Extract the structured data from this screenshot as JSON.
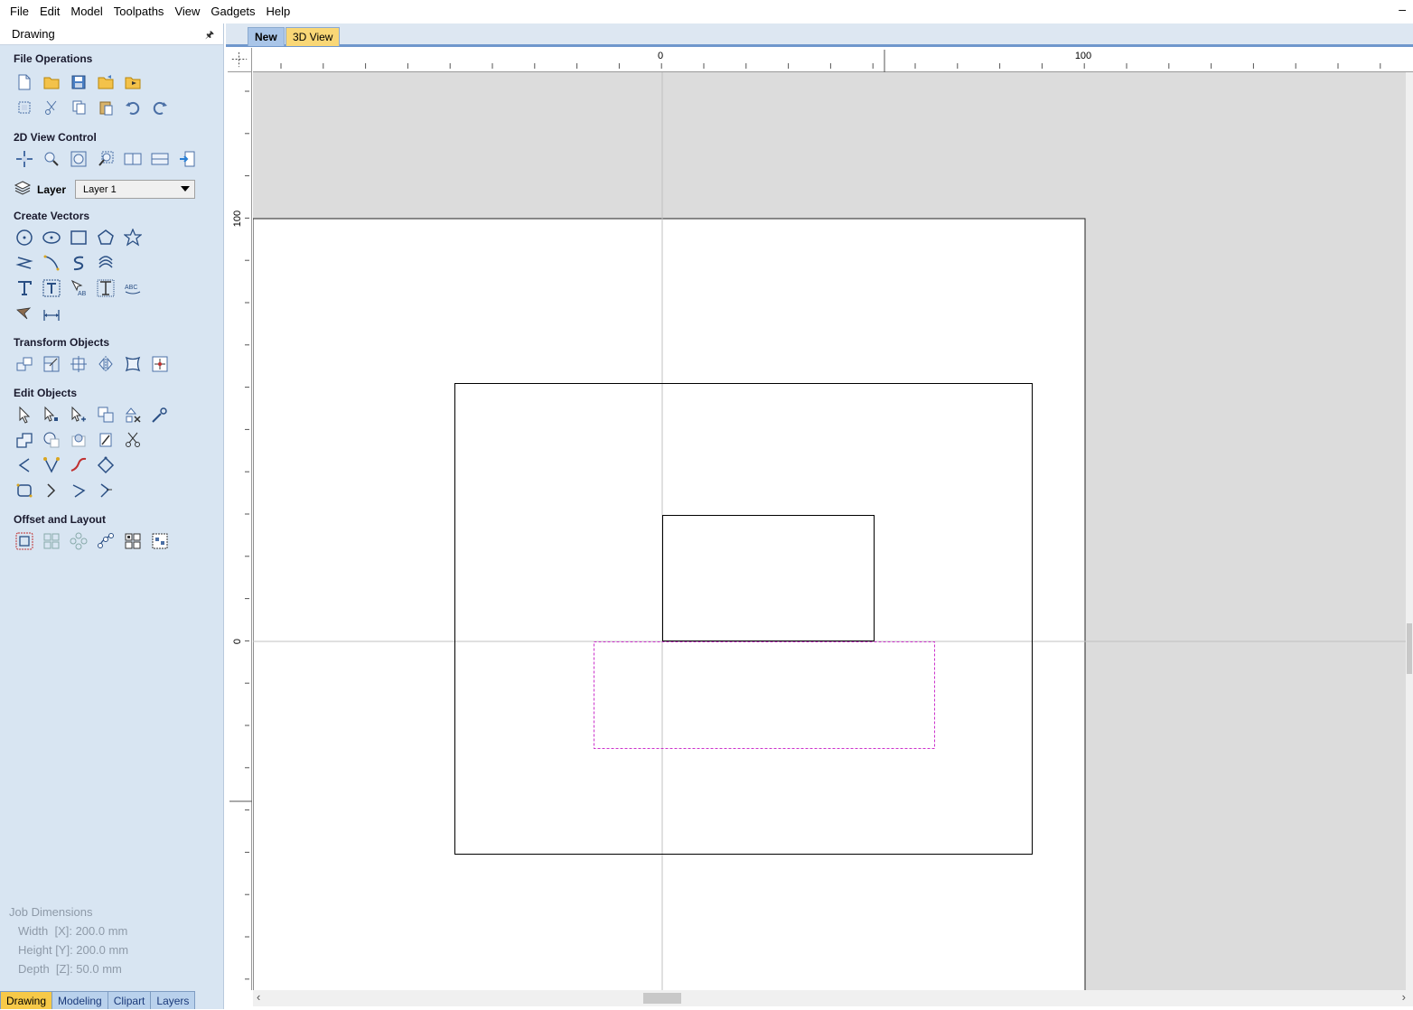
{
  "menu": [
    "File",
    "Edit",
    "Model",
    "Toolpaths",
    "View",
    "Gadgets",
    "Help"
  ],
  "menu_minimize": "–",
  "panel": {
    "title": "Drawing",
    "pin": "🖈",
    "sections": {
      "file_operations": "File Operations",
      "view_control": "2D View Control",
      "create_vectors": "Create Vectors",
      "transform_objects": "Transform Objects",
      "edit_objects": "Edit Objects",
      "offset_layout": "Offset and Layout"
    },
    "layer": {
      "label": "Layer",
      "selected": "Layer 1"
    }
  },
  "job_dimensions": {
    "title": "Job Dimensions",
    "width": "Width  [X]: 200.0 mm",
    "height": "Height [Y]: 200.0 mm",
    "depth": "Depth  [Z]: 50.0 mm"
  },
  "bottom_tabs": [
    "Drawing",
    "Modeling",
    "Clipart",
    "Layers"
  ],
  "doc_tabs": [
    "New",
    "3D View"
  ],
  "rulers": {
    "h_labels": [
      "0",
      "100"
    ],
    "v_labels": [
      "100",
      "0"
    ]
  },
  "colors": {
    "panel_bg": "#d8e5f2",
    "selection": "#cc33cc",
    "canvas_bg": "#dcdcdc",
    "tab_active": "#f7c948"
  }
}
